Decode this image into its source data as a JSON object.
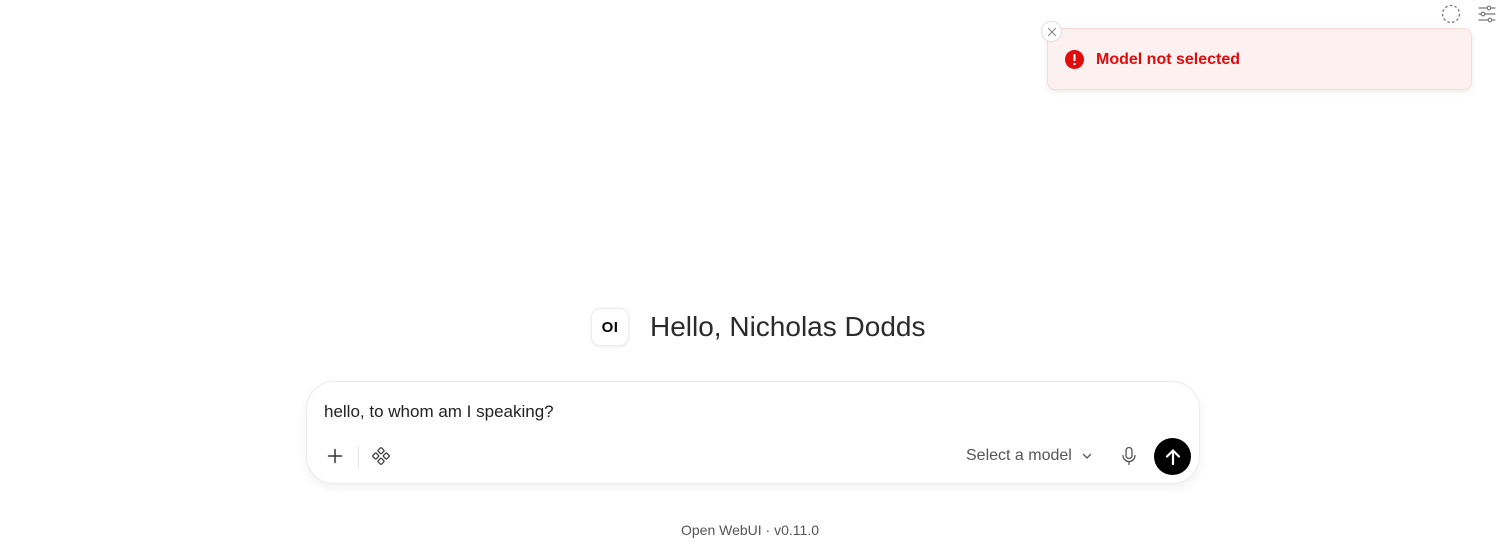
{
  "toast": {
    "message": "Model not selected",
    "icon": "exclamation-circle-icon",
    "text_color": "#e00b0b",
    "background": "#fdf0f0"
  },
  "greeting": {
    "logo_text": "OI",
    "text": "Hello, Nicholas Dodds"
  },
  "chat": {
    "input_value": "hello, to whom am I speaking?",
    "model_selector_label": "Select a model",
    "send_button_color": "#000000"
  },
  "top_controls": {
    "icons": [
      "temporary-chat-icon",
      "settings-sliders-icon"
    ]
  },
  "footer": {
    "text": "Open WebUI · v0.11.0"
  }
}
